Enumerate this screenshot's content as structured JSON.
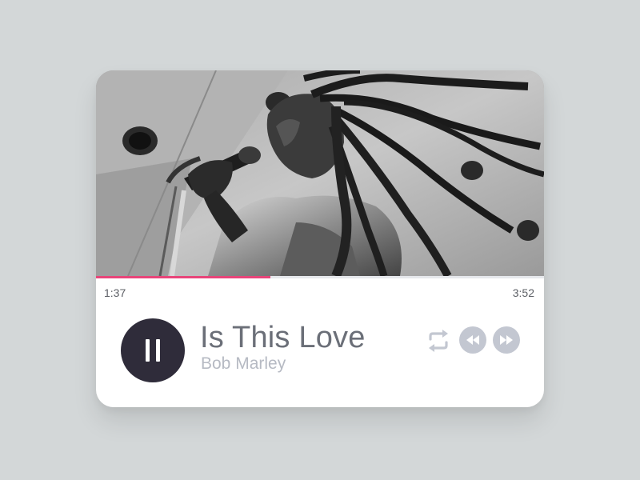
{
  "player": {
    "progress": 0.39,
    "elapsed": "1:37",
    "total": "3:52",
    "track_title": "Is This Love",
    "artist": "Bob Marley",
    "accent_color": "#e8457a",
    "play_button_color": "#2f2c3a",
    "controls": {
      "primary_icon": "pause-icon",
      "repeat_icon": "repeat-icon",
      "rewind_icon": "rewind-icon",
      "forward_icon": "fast-forward-icon"
    }
  },
  "cover": {
    "image_type": "black-and-white concert photo of singer at microphone"
  }
}
